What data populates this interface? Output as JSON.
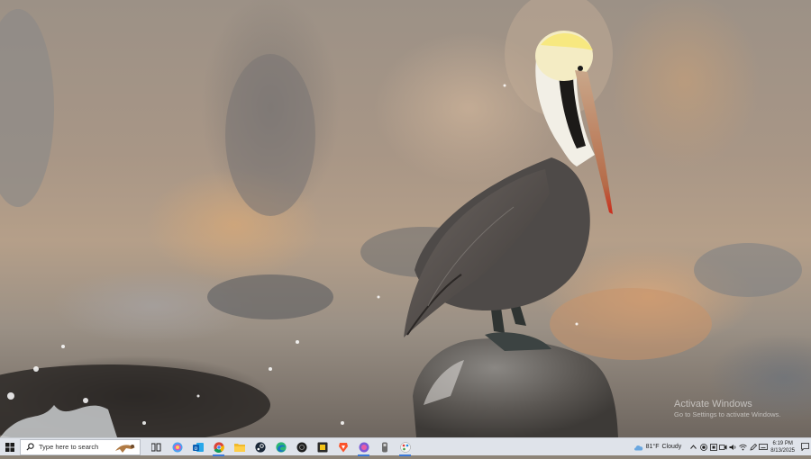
{
  "desktop": {
    "watermark": {
      "title": "Activate Windows",
      "subtitle": "Go to Settings to activate Windows."
    }
  },
  "taskbar": {
    "search_placeholder": "Type here to search",
    "pinned_apps": [
      {
        "icon": "task-view-icon"
      },
      {
        "icon": "copilot-icon"
      },
      {
        "icon": "outlook-icon"
      },
      {
        "icon": "chrome-icon",
        "active": true
      },
      {
        "icon": "file-explorer-icon"
      },
      {
        "icon": "steam-icon"
      },
      {
        "icon": "edge-icon"
      },
      {
        "icon": "app-dark-circle-icon"
      },
      {
        "icon": "app-yellow-square-icon"
      },
      {
        "icon": "brave-icon"
      },
      {
        "icon": "app-purple-icon",
        "active": true
      },
      {
        "icon": "app-gray-icon"
      },
      {
        "icon": "paint-icon",
        "active": true
      }
    ],
    "weather": {
      "temp": "81°F",
      "condition": "Cloudy"
    },
    "tray_icons": [
      "chevron-up-icon",
      "record-icon",
      "app-tray-icon",
      "meet-icon",
      "volume-icon",
      "wifi-icon",
      "pen-icon",
      "keyboard-icon"
    ],
    "clock": {
      "time": "6:19 PM",
      "date": "8/13/2025"
    }
  },
  "colors": {
    "taskbar_bg": "#dfe3ea",
    "accent": "#3b78d8"
  }
}
